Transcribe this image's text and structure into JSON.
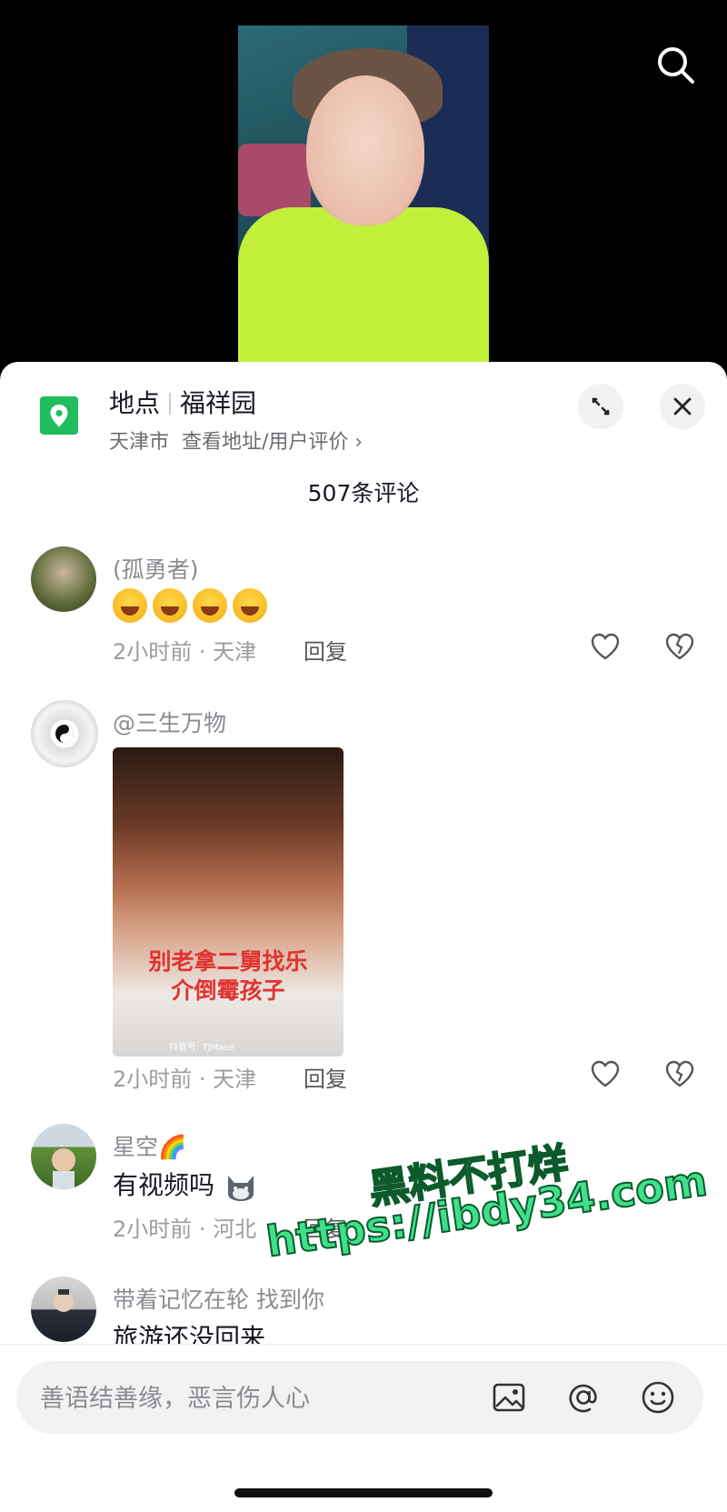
{
  "location": {
    "label": "地点",
    "name": "福祥园",
    "city": "天津市",
    "link": "查看地址/用户评价 ›"
  },
  "comment_count": "507条评论",
  "comments": [
    {
      "author": "(孤勇者)",
      "emoji_count": 4,
      "time_place": "2小时前 · 天津",
      "reply": "回复"
    },
    {
      "author": "@三生万物",
      "image_caption_1": "别老拿二舅找乐",
      "image_caption_2": "介倒霉孩子",
      "image_watermark": "抖音号: TJMase",
      "time_place": "2小时前 · 天津",
      "reply": "回复"
    },
    {
      "author": "星空🌈",
      "text": "有视频吗",
      "time_place": "2小时前 · 河北",
      "reply": "回复"
    },
    {
      "author": "带着记忆在轮   找到你",
      "text": "旅游还没回来"
    }
  ],
  "watermark": {
    "line1": "黑料不打烊",
    "line2": "https://ibdy34.com"
  },
  "input": {
    "placeholder": "善语结善缘，恶言伤人心"
  },
  "colors": {
    "location_icon": "#1fbd5d",
    "shirt": "#c2f03a",
    "watermark": "#3ee08a"
  }
}
